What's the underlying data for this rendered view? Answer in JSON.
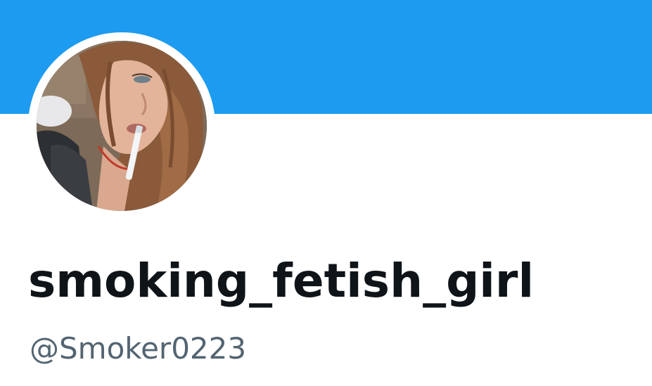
{
  "profile": {
    "display_name": "smoking_fetish_girl",
    "handle": "@Smoker0223",
    "avatar_icon": "profile-photo-avatar"
  },
  "colors": {
    "banner": "#1d9bf0",
    "name_text": "#0f1419",
    "handle_text": "#536471",
    "background": "#ffffff"
  }
}
